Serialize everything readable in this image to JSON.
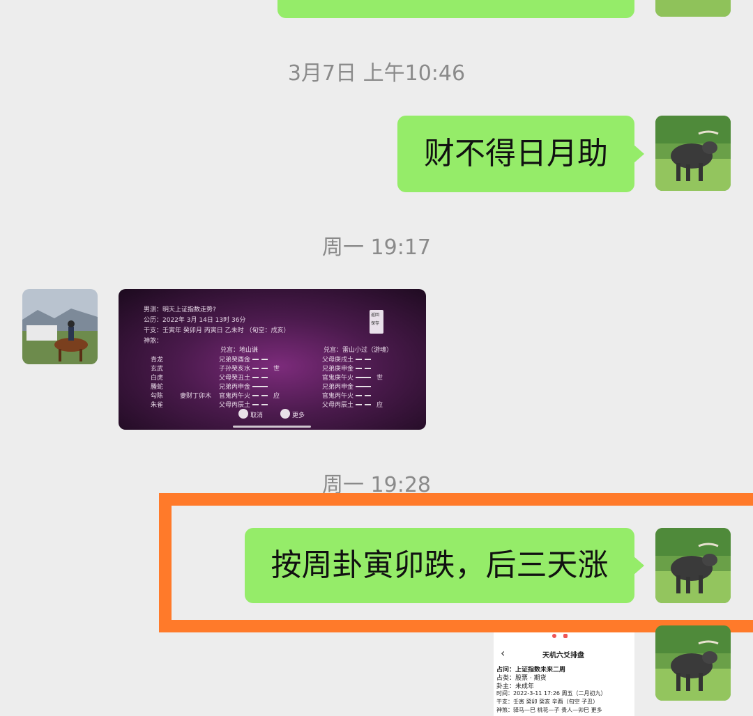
{
  "timestamps": [
    "3月7日 上午10:46",
    "周一 19:17",
    "周一 19:28"
  ],
  "messages": [
    {
      "text": "财不得日月助"
    },
    {
      "text": "按周卦寅卯跌，后三天涨"
    }
  ],
  "image_message_1": {
    "lines": [
      "男测：明天上证指数走势?",
      "公历：2022年 3月 14日 13时 36分",
      "干支：壬寅年 癸卯月 丙寅日 乙未时 （旬空：戌亥）",
      "神煞："
    ],
    "header_left": "兑宫：地山谦",
    "header_right": "兑宫：雷山小过（游魂）",
    "six_gods": [
      "青龙",
      "玄武",
      "白虎",
      "螣蛇",
      "勾陈",
      "朱雀"
    ],
    "hidden": "妻财丁卯木",
    "left_yao": [
      "兄弟癸酉金",
      "子孙癸亥水",
      "父母癸丑土",
      "兄弟丙申金",
      "官鬼丙午火",
      "父母丙辰土"
    ],
    "left_mark": [
      "",
      "世",
      "",
      "",
      "应",
      ""
    ],
    "right_yao": [
      "父母庚戌土",
      "兄弟庚申金",
      "官鬼庚午火",
      "兄弟丙申金",
      "官鬼丙午火",
      "父母丙辰土"
    ],
    "right_mark": [
      "",
      "",
      "世",
      "",
      "",
      "应"
    ],
    "btn1": "返回",
    "btn2": "保存",
    "bottom_btn1": "取消",
    "bottom_btn2": "更多"
  },
  "image_message_2": {
    "title": "天机六爻排盘",
    "rows": [
      "占问：上证指数未来二周",
      "占类：股票 · 期货",
      "卦主：未成年",
      "时间：2022-3-11 17:26 周五（二月初九）",
      "干支：壬寅 癸卯 癸亥 辛酉（旬空 子丑）",
      "神煞：驿马—巳  桃花—子  贵人—卯巳  更多"
    ]
  },
  "colors": {
    "background": "#ededed",
    "bubble_green": "#95ec69",
    "highlight_orange": "#ff7a2a",
    "timestamp_gray": "#8a8a8a"
  }
}
